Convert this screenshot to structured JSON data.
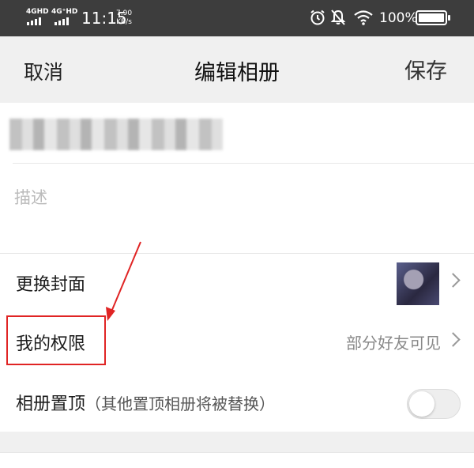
{
  "status_bar": {
    "net1": "4GHD",
    "net2": "4G⁺HD",
    "time": "11:15",
    "speed_value": "7.90",
    "speed_unit": "KB/s",
    "battery_text": "100%",
    "battery_level": 1.0
  },
  "header": {
    "cancel_label": "取消",
    "title": "编辑相册",
    "save_label": "保存"
  },
  "album_form": {
    "description_placeholder": "描述"
  },
  "settings": {
    "cover_label": "更换封面",
    "permission_label": "我的权限",
    "permission_value": "部分好友可见",
    "pin_label": "相册置顶",
    "pin_note": "（其他置顶相册将被替换）",
    "pin_enabled": false
  },
  "annotation": {
    "color": "#e02424"
  }
}
